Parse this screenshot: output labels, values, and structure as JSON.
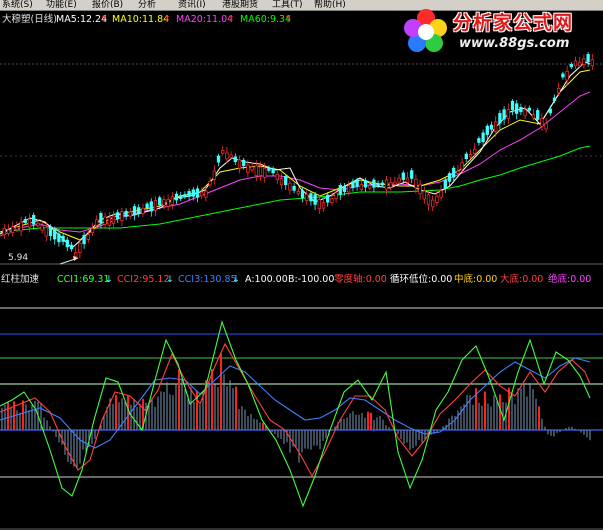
{
  "menu": {
    "items": [
      "系统(S)",
      "功能(E)",
      "报价(B)",
      "分析",
      "资讯(I)",
      "港股期货",
      "工具(T)",
      "帮助(H)"
    ]
  },
  "main_legend": {
    "name": "大穆塑(日线)",
    "ma5": "MA5:12.24",
    "ma10": "MA10:11.84",
    "ma20": "MA20:11.04",
    "ma60": "MA60:9.34",
    "arrow": "↑"
  },
  "watermark": {
    "title": "分析家公式网",
    "url": "www.88gs.com"
  },
  "price_labels": {
    "low": "5.94"
  },
  "indicator_legend": {
    "name": "红柱加速",
    "cci1": "CCI1:69.31",
    "cci2": "CCI2:95.12",
    "cci3": "CCI3:130.85",
    "a": "A:100.00",
    "b": "B:-100.00",
    "zero": "零度轴:0.00",
    "cycle_low": "循环低位:0.00",
    "mid_bottom": "中底:0.00",
    "big_bottom": "大底:0.00",
    "abs_bottom": "绝底:0.00",
    "down_arrow": "↓"
  },
  "colors": {
    "up": "#ff3030",
    "down": "#40ffff",
    "ma5": "#ffffff",
    "ma10": "#ffff00",
    "ma20": "#ff40ff",
    "ma60": "#00ff00",
    "cci1": "#40ff40",
    "cci2": "#ff4040",
    "cci3": "#4080ff"
  }
}
